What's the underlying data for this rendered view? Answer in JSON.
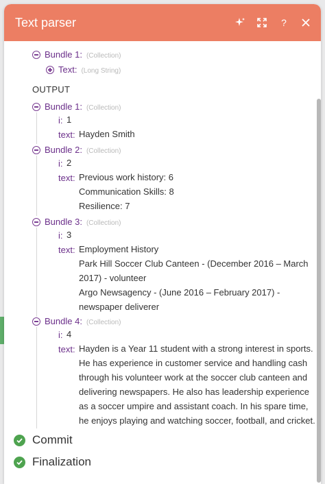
{
  "panel": {
    "title": "Text parser",
    "icons": [
      "sparkle-icon",
      "expand-icon",
      "help-icon",
      "close-icon"
    ]
  },
  "input": {
    "bundle1": {
      "name": "Bundle 1:",
      "type": "(Collection)"
    },
    "text_key": {
      "name": "Text:",
      "type": "(Long String)"
    }
  },
  "output_label": "OUTPUT",
  "bundles": [
    {
      "name": "Bundle 1:",
      "type": "(Collection)",
      "i_key": "i:",
      "i_val": "1",
      "text_key": "text:",
      "lines": [
        "Hayden Smith"
      ]
    },
    {
      "name": "Bundle 2:",
      "type": "(Collection)",
      "i_key": "i:",
      "i_val": "2",
      "text_key": "text:",
      "lines": [
        "Previous work history: 6",
        "Communication Skills: 8",
        "Resilience: 7"
      ]
    },
    {
      "name": "Bundle 3:",
      "type": "(Collection)",
      "i_key": "i:",
      "i_val": "3",
      "text_key": "text:",
      "lines": [
        "Employment History",
        "Park Hill Soccer Club Canteen - (December 2016 – March",
        "2017) - volunteer",
        "Argo Newsagency - (June 2016 – February 2017) -",
        "newspaper deliverer"
      ]
    },
    {
      "name": "Bundle 4:",
      "type": "(Collection)",
      "i_key": "i:",
      "i_val": "4",
      "text_key": "text:",
      "lines": [
        "Hayden is a Year 11 student with a strong interest in sports.",
        "He has experience in customer service and handling cash",
        "through his volunteer work at the soccer club canteen and",
        "delivering newspapers. He also has leadership experience",
        "as a soccer umpire and assistant coach. In his spare time,",
        "he enjoys playing and watching soccer, football, and cricket."
      ]
    }
  ],
  "statuses": [
    "Commit",
    "Finalization"
  ],
  "colors": {
    "header": "#ec7e63",
    "accent": "#6b2f8a",
    "success": "#4ea34f"
  }
}
